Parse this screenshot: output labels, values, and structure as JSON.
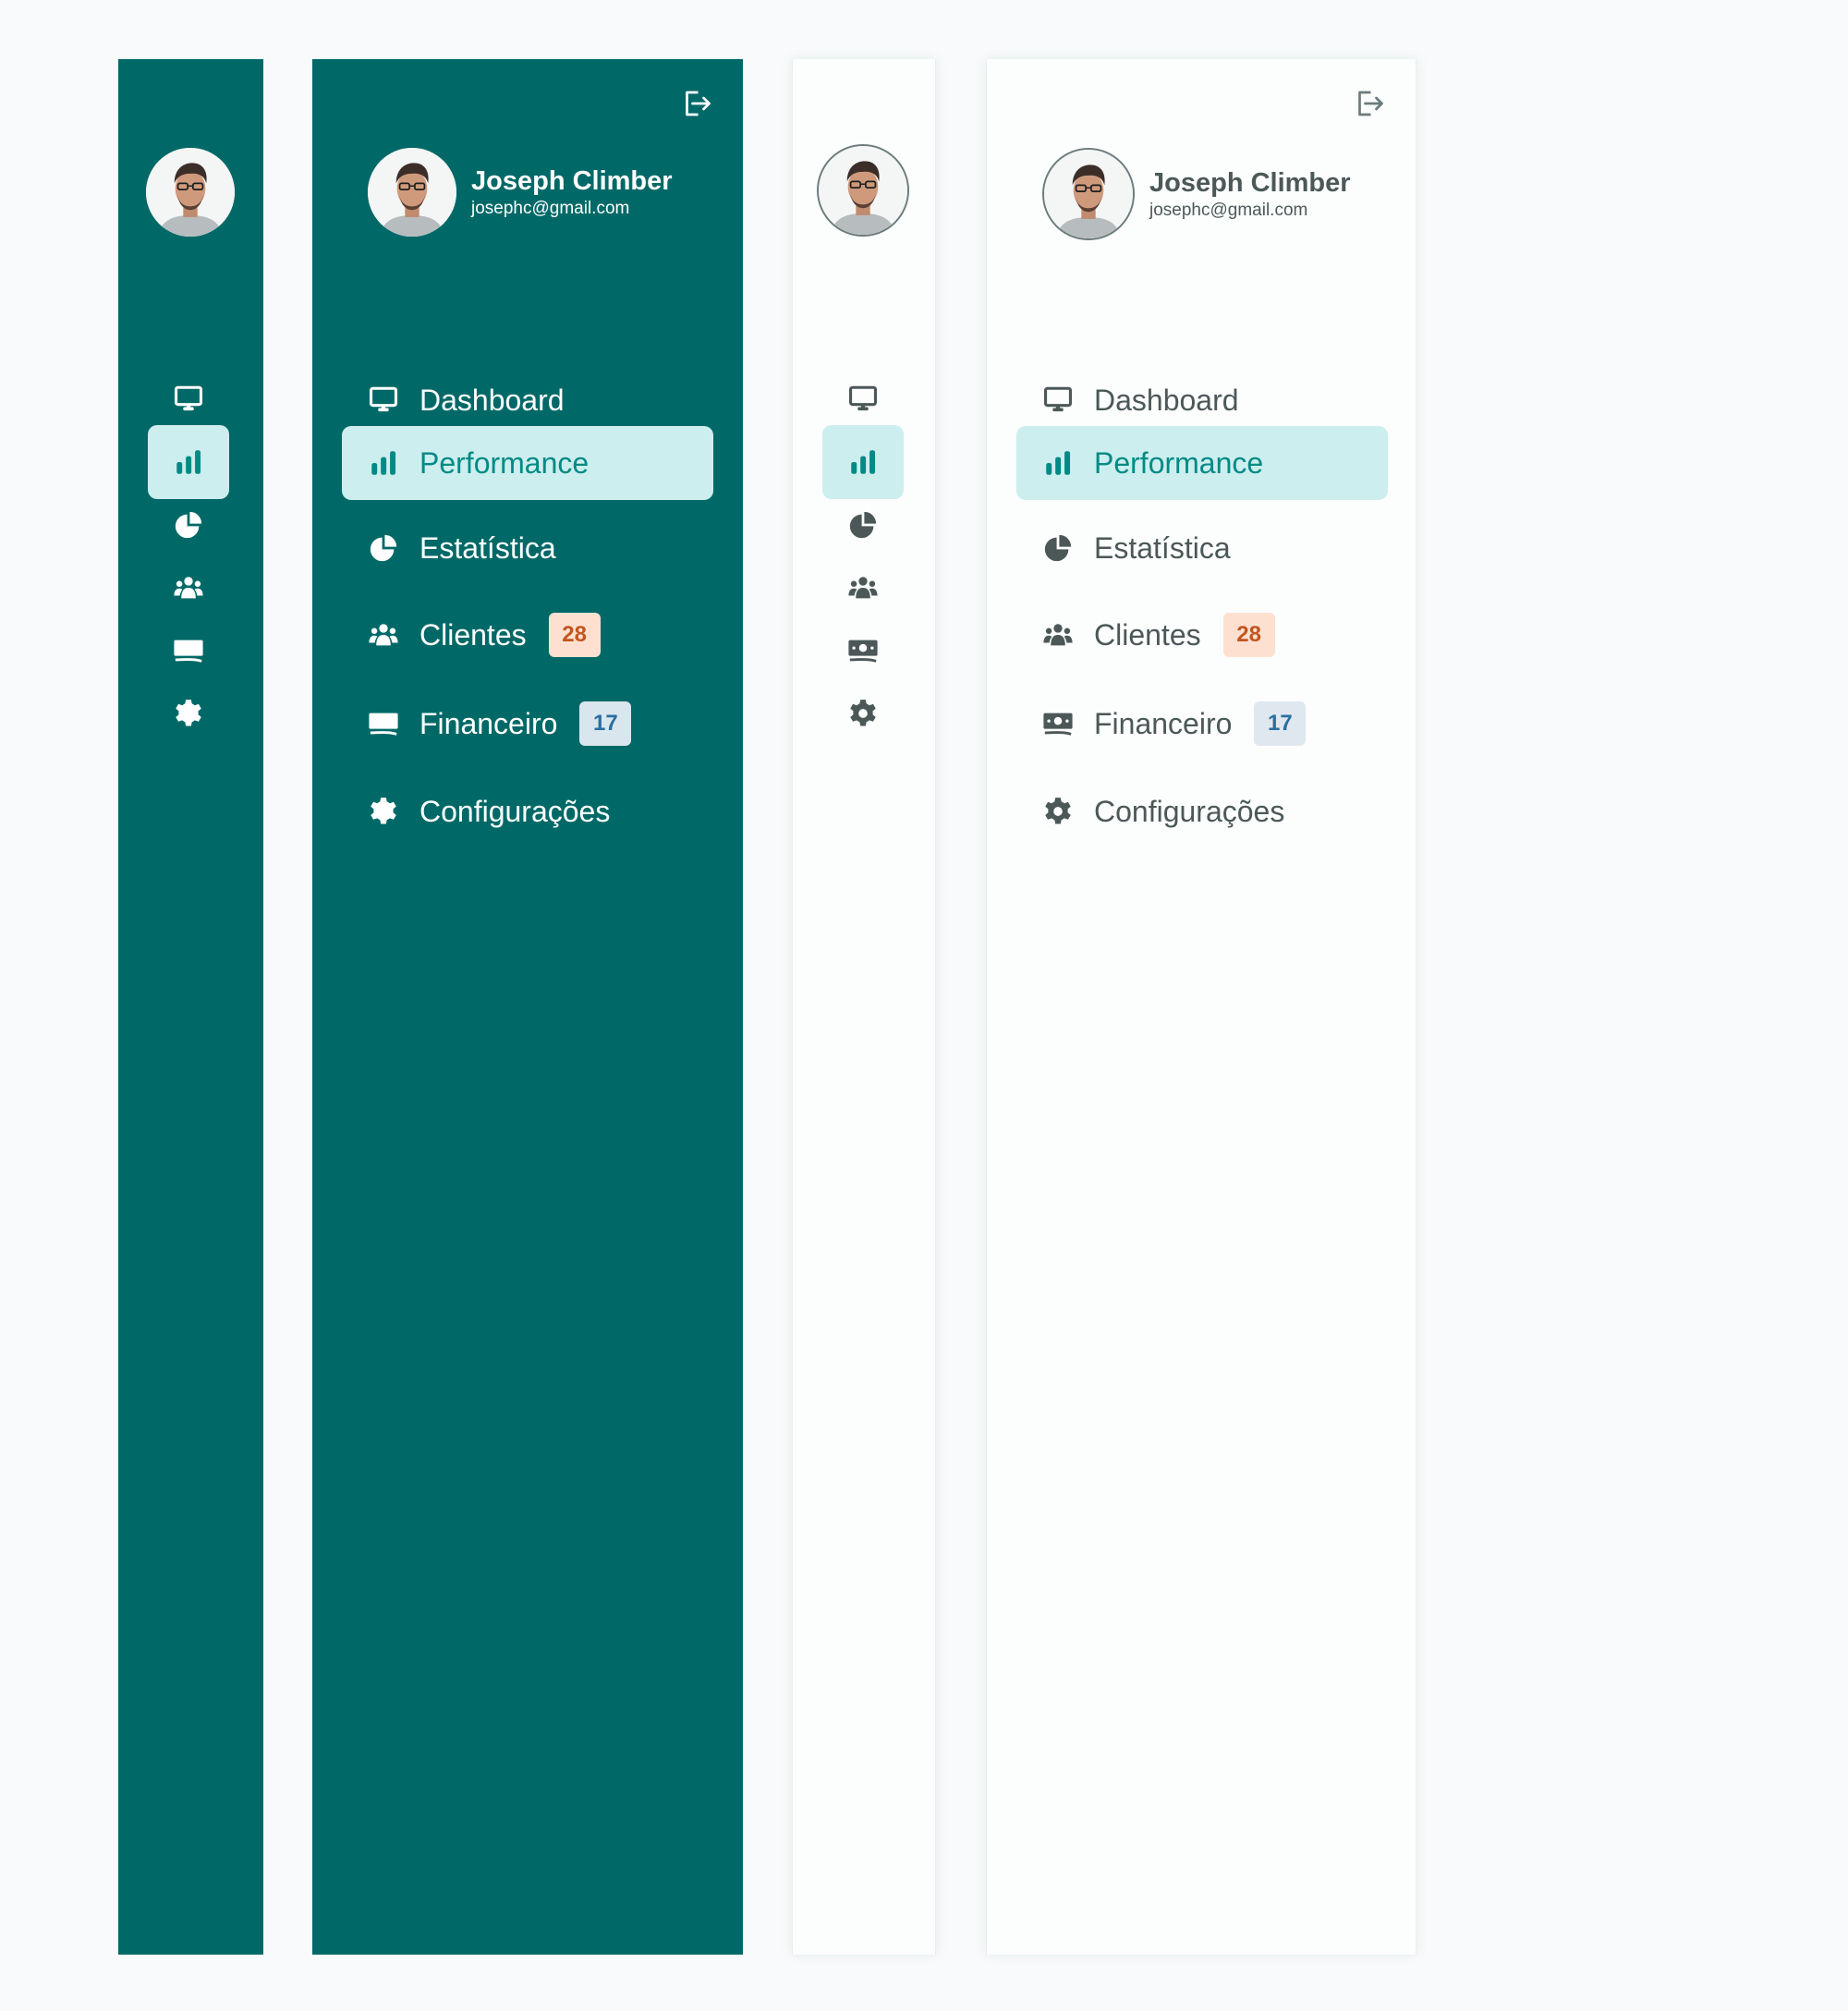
{
  "user": {
    "name": "Joseph Climber",
    "email": "josephc@gmail.com"
  },
  "nav": {
    "items": [
      {
        "label": "Dashboard",
        "icon": "monitor-icon"
      },
      {
        "label": "Performance",
        "icon": "bar-chart-icon",
        "active": true
      },
      {
        "label": "Estatística",
        "icon": "pie-chart-icon"
      },
      {
        "label": "Clientes",
        "icon": "users-icon",
        "badge": "28"
      },
      {
        "label": "Financeiro",
        "icon": "money-icon",
        "badge": "17"
      },
      {
        "label": "Configurações",
        "icon": "gear-icon"
      }
    ]
  },
  "colors": {
    "teal": "#006967",
    "active_bg": "#cdeeee",
    "active_text": "#008a85",
    "badge_orange_bg": "#fde0d0",
    "badge_orange_text": "#c2561f",
    "badge_blue_bg": "#dfe8ee",
    "badge_blue_text": "#2a6fa0",
    "light_text": "#4c5858"
  }
}
